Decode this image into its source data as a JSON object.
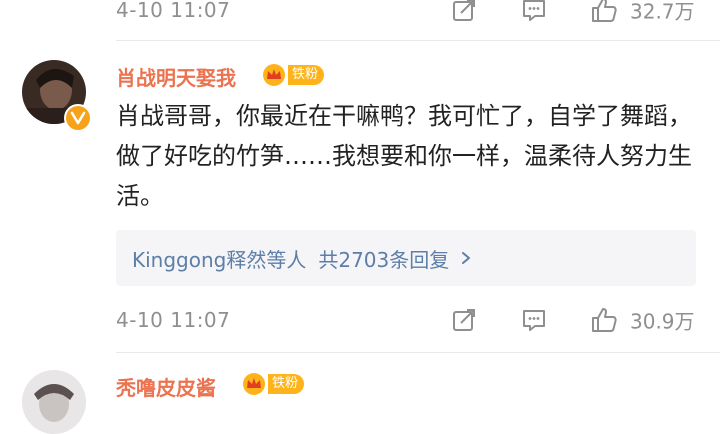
{
  "comments": [
    {
      "time": "4-10 11:07",
      "likes": "32.7万"
    },
    {
      "username": "肖战明天娶我",
      "fan_badge": "铁粉",
      "text": "肖战哥哥，你最近在干嘛鸭？我可忙了，自学了舞蹈，做了好吃的竹笋……我想要和你一样，温柔待人努力生活。",
      "reply_users": "Kinggong释然等人",
      "reply_count": "共2703条回复",
      "time": "4-10 11:07",
      "likes": "30.9万"
    },
    {
      "username": "秃噜皮皮酱",
      "fan_badge": "铁粉"
    }
  ],
  "icons": {
    "share": "share-icon",
    "comment": "comment-icon",
    "like": "like-icon",
    "verified": "verified-badge-icon",
    "crown": "crown-icon",
    "chevron": "chevron-right-icon"
  },
  "colors": {
    "username": "#eb7350",
    "reply_link": "#5d7ea8",
    "meta_gray": "#8f8f8f",
    "badge_orange": "#ffb31a",
    "reply_bg": "#f5f5f7"
  }
}
